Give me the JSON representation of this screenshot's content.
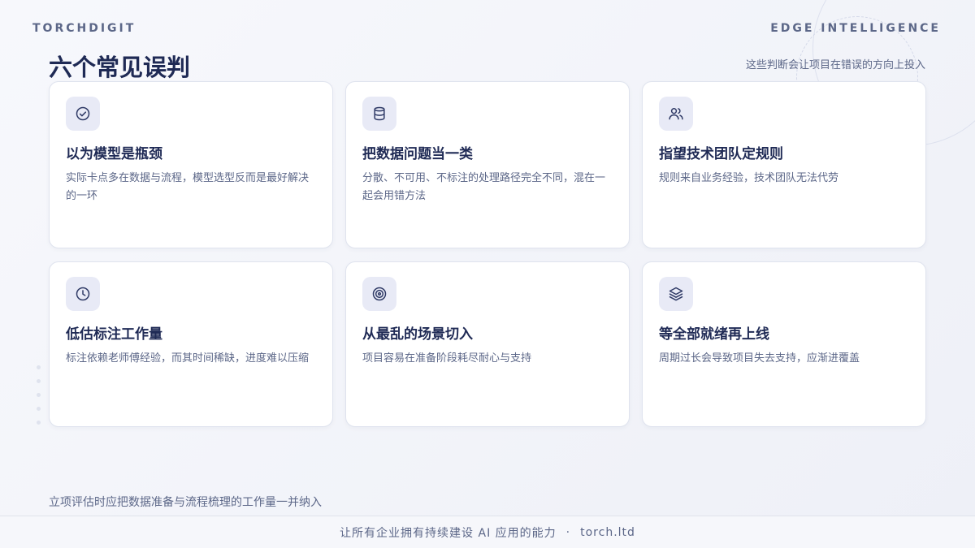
{
  "header": {
    "brand_left": "TORCHDIGIT",
    "brand_right": "EDGE INTELLIGENCE",
    "title": "六个常见误判",
    "subtitle": "这些判断会让项目在错误的方向上投入"
  },
  "cards": [
    {
      "icon": "check-circle-icon",
      "title": "以为模型是瓶颈",
      "desc": "实际卡点多在数据与流程，模型选型反而是最好解决的一环"
    },
    {
      "icon": "database-icon",
      "title": "把数据问题当一类",
      "desc": "分散、不可用、不标注的处理路径完全不同，混在一起会用错方法"
    },
    {
      "icon": "users-icon",
      "title": "指望技术团队定规则",
      "desc": "规则来自业务经验，技术团队无法代劳"
    },
    {
      "icon": "clock-icon",
      "title": "低估标注工作量",
      "desc": "标注依赖老师傅经验，而其时间稀缺，进度难以压缩"
    },
    {
      "icon": "target-icon",
      "title": "从最乱的场景切入",
      "desc": "项目容易在准备阶段耗尽耐心与支持"
    },
    {
      "icon": "layers-icon",
      "title": "等全部就绪再上线",
      "desc": "周期过长会导致项目失去支持，应渐进覆盖"
    }
  ],
  "footer": {
    "note": "立项评估时应把数据准备与流程梳理的工作量一并纳入",
    "slogan": "让所有企业拥有持续建设 AI 应用的能力",
    "separator": "·",
    "site": "torch.ltd"
  },
  "colors": {
    "accent": "#1f2a55",
    "muted": "#5c6788",
    "icon_bg": "#e8eaf6",
    "card_border": "#dfe3ee"
  }
}
